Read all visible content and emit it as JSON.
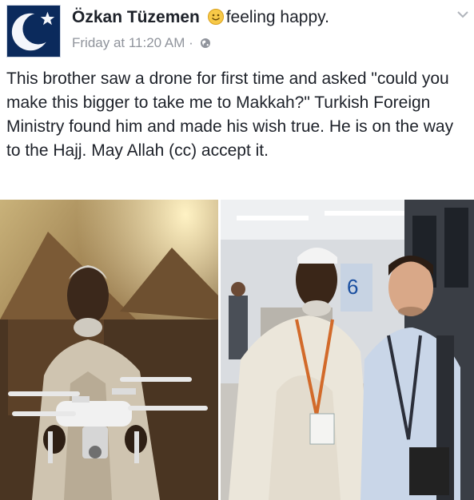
{
  "post": {
    "author": "Özkan Tüzemen",
    "feeling": "feeling happy.",
    "timestamp": "Friday at 11:20 AM",
    "separator": "·",
    "privacy_icon": "globe-icon",
    "avatar_icon": "crescent-star-icon",
    "menu_icon": "chevron-down-icon",
    "text": "This brother saw a drone for first time and asked \"could you make this bigger to take me to Makkah?\" Turkish Foreign Ministry found him and made his wish true. He is on the way to the Hajj. May Allah (cc) accept it."
  },
  "photos": {
    "right_sign": "6"
  },
  "colors": {
    "avatar_bg": "#0b2a5c",
    "meta_gray": "#90949c",
    "text": "#1d2129"
  }
}
